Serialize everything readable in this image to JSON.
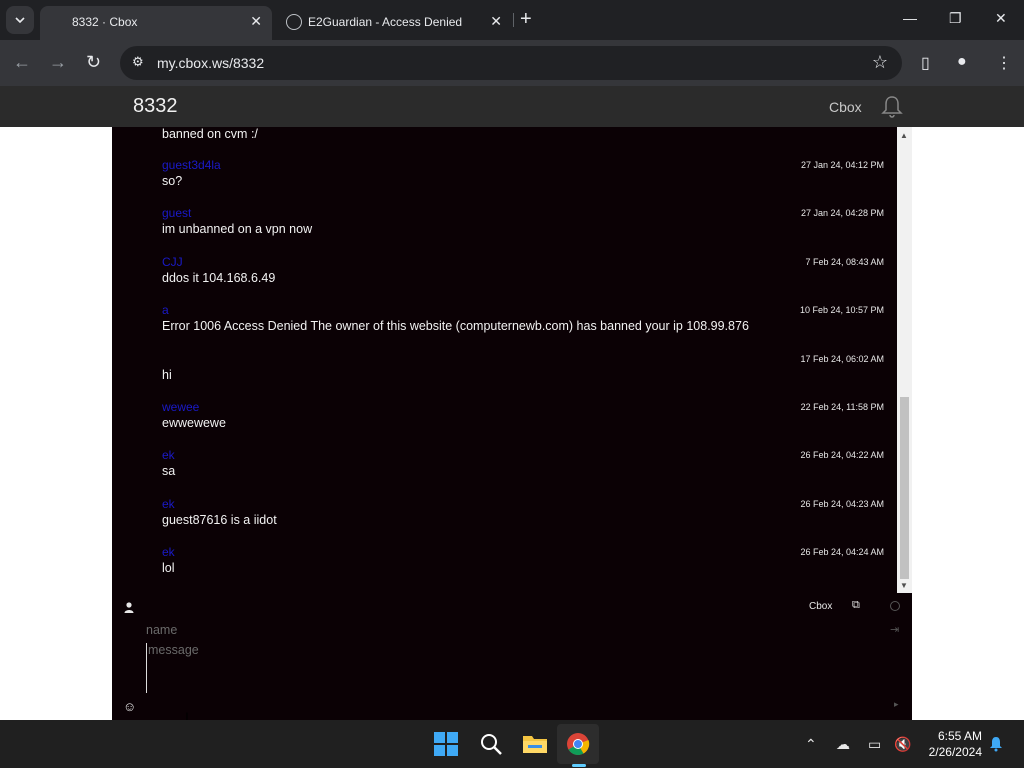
{
  "browser": {
    "tabs": [
      {
        "title": "8332 · Cbox",
        "active": true
      },
      {
        "title": "E2Guardian - Access Denied",
        "active": false
      }
    ],
    "url": "my.cbox.ws/8332"
  },
  "page": {
    "title": "8332",
    "cbox_link": "Cbox"
  },
  "chat": {
    "first_line": "banned on cvm :/",
    "messages": [
      {
        "name": "guest3d4la",
        "time": "27 Jan 24, 04:12 PM",
        "text": "so?"
      },
      {
        "name": "guest",
        "time": "27 Jan 24, 04:28 PM",
        "text": "im unbanned on a vpn now"
      },
      {
        "name": "CJJ",
        "time": "7 Feb 24, 08:43 AM",
        "text": "ddos it 104.168.6.49"
      },
      {
        "name": "a",
        "time": "10 Feb 24, 10:57 PM",
        "text": "Error 1006 Access Denied The owner of this website (computernewb.com) has banned your ip 108.99.876"
      },
      {
        "name": "",
        "time": "17 Feb 24, 06:02 AM",
        "text": "hi"
      },
      {
        "name": "wewee",
        "time": "22 Feb 24, 11:58 PM",
        "text": "ewwewewe"
      },
      {
        "name": "ek",
        "time": "26 Feb 24, 04:22 AM",
        "text": "sa"
      },
      {
        "name": "ek",
        "time": "26 Feb 24, 04:23 AM",
        "text": "guest87616 is a iidot"
      },
      {
        "name": "ek",
        "time": "26 Feb 24, 04:24 AM",
        "text": "lol"
      }
    ]
  },
  "input": {
    "cbox_label": "Cbox",
    "name_placeholder": "name",
    "message_placeholder": "message"
  },
  "taskbar": {
    "time": "6:55 AM",
    "date": "2/26/2024"
  },
  "colors": {
    "chat_bg": "#0b0105",
    "name_color": "#1a1ac8",
    "header_bg": "#2b2b2b"
  }
}
